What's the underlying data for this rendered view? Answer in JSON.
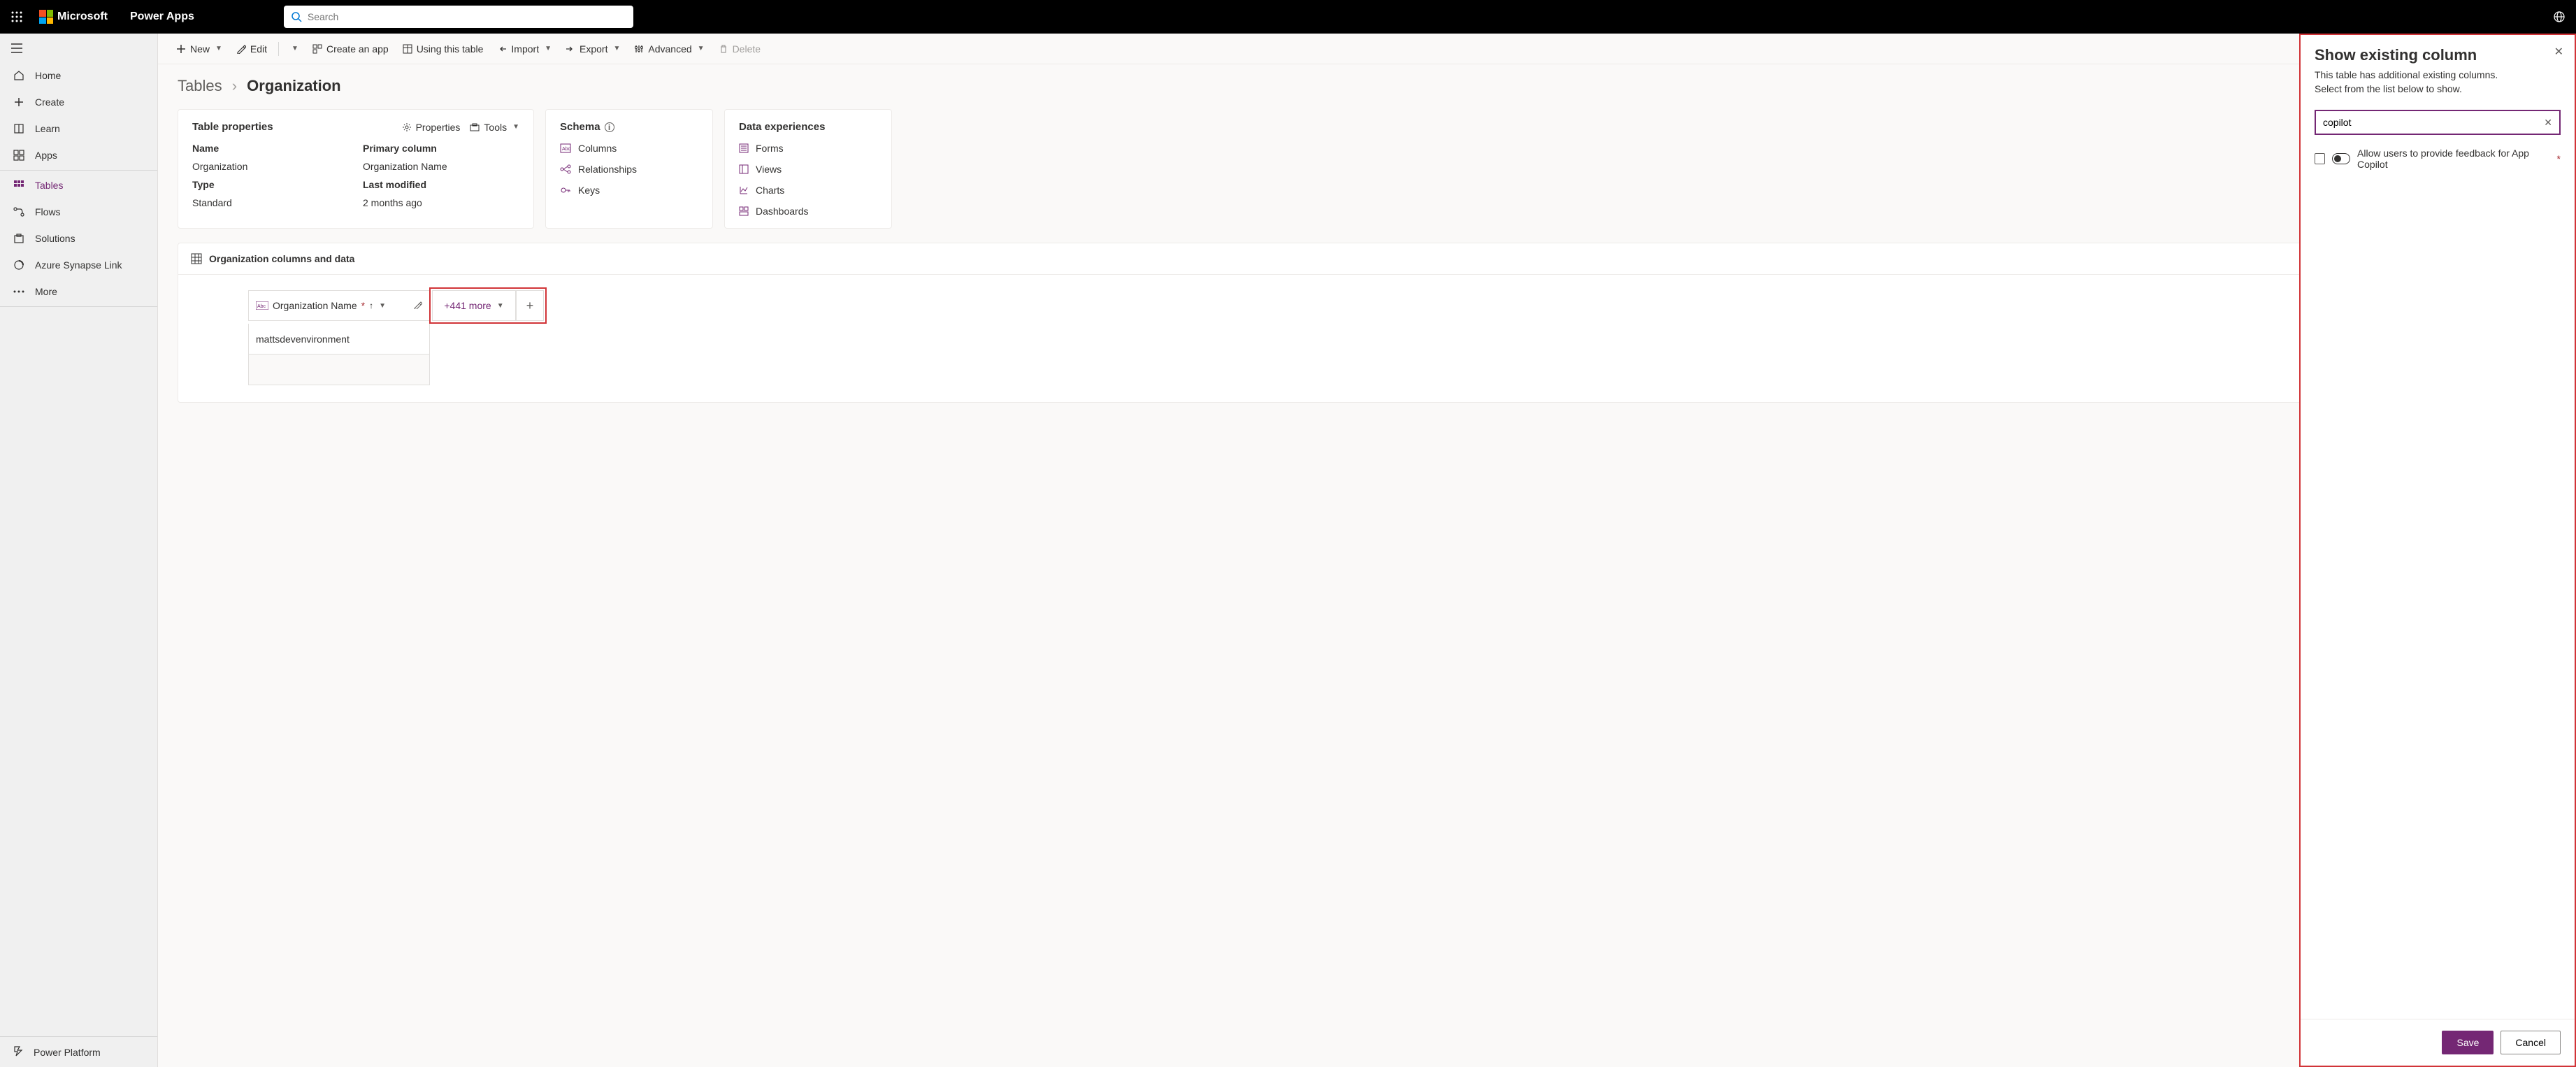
{
  "header": {
    "brand": "Microsoft",
    "app": "Power Apps",
    "search_placeholder": "Search"
  },
  "sidebar": {
    "items": [
      {
        "label": "Home",
        "icon": "home"
      },
      {
        "label": "Create",
        "icon": "plus"
      },
      {
        "label": "Learn",
        "icon": "book"
      },
      {
        "label": "Apps",
        "icon": "apps"
      },
      {
        "label": "Tables",
        "icon": "grid",
        "active": true
      },
      {
        "label": "Flows",
        "icon": "flow"
      },
      {
        "label": "Solutions",
        "icon": "solutions"
      },
      {
        "label": "Azure Synapse Link",
        "icon": "synapse"
      },
      {
        "label": "More",
        "icon": "more"
      }
    ],
    "footer": "Power Platform"
  },
  "commandbar": {
    "new": "New",
    "edit": "Edit",
    "create_app": "Create an app",
    "using_table": "Using this table",
    "import": "Import",
    "export": "Export",
    "advanced": "Advanced",
    "delete": "Delete"
  },
  "breadcrumb": {
    "root": "Tables",
    "current": "Organization"
  },
  "props_card": {
    "title": "Table properties",
    "properties_link": "Properties",
    "tools_link": "Tools",
    "name_label": "Name",
    "name_value": "Organization",
    "primary_label": "Primary column",
    "primary_value": "Organization Name",
    "type_label": "Type",
    "type_value": "Standard",
    "modified_label": "Last modified",
    "modified_value": "2 months ago"
  },
  "schema_card": {
    "title": "Schema",
    "columns": "Columns",
    "relationships": "Relationships",
    "keys": "Keys"
  },
  "dataexp_card": {
    "title": "Data experiences",
    "forms": "Forms",
    "views": "Views",
    "charts": "Charts",
    "dashboards": "Dashboards"
  },
  "data_section": {
    "title": "Organization columns and data",
    "primary_col": "Organization Name",
    "more_label": "+441 more",
    "row1": "mattsdevenvironment"
  },
  "panel": {
    "title": "Show existing column",
    "desc1": "This table has additional existing columns.",
    "desc2": "Select from the list below to show.",
    "search_value": "copilot",
    "option1": "Allow users to provide feedback for App Copilot",
    "save": "Save",
    "cancel": "Cancel"
  }
}
